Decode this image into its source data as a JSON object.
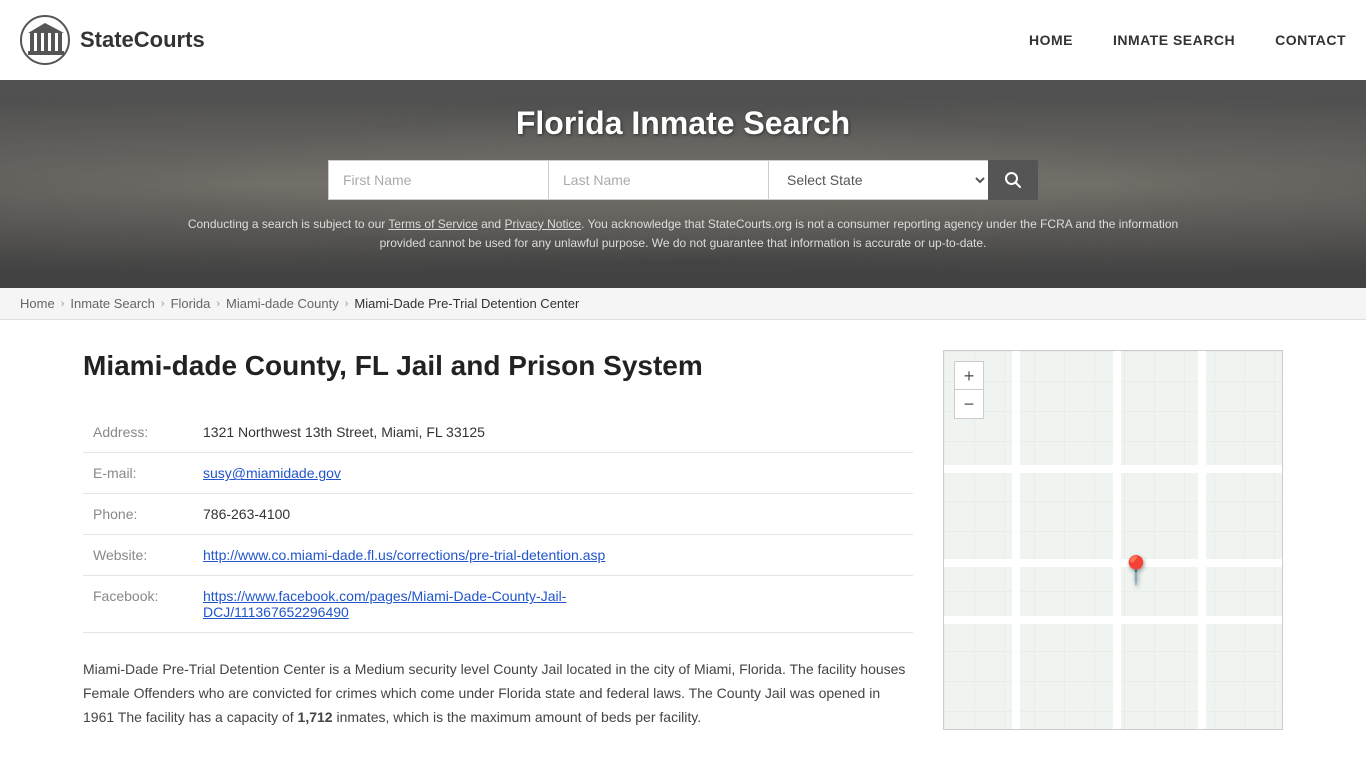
{
  "site": {
    "logo_text": "StateCourts",
    "title": "Florida Inmate Search"
  },
  "nav": {
    "home_label": "HOME",
    "inmate_search_label": "INMATE SEARCH",
    "contact_label": "CONTACT"
  },
  "search": {
    "first_name_placeholder": "First Name",
    "last_name_placeholder": "Last Name",
    "state_placeholder": "Select State",
    "search_button_label": "🔍"
  },
  "disclaimer": {
    "text_before_tos": "Conducting a search is subject to our ",
    "tos_label": "Terms of Service",
    "text_between": " and ",
    "privacy_label": "Privacy Notice",
    "text_after": ". You acknowledge that StateCourts.org is not a consumer reporting agency under the FCRA and the information provided cannot be used for any unlawful purpose. We do not guarantee that information is accurate or up-to-date."
  },
  "breadcrumb": {
    "home": "Home",
    "inmate_search": "Inmate Search",
    "state": "Florida",
    "county": "Miami-dade County",
    "facility": "Miami-Dade Pre-Trial Detention Center"
  },
  "facility": {
    "heading": "Miami-dade County, FL Jail and Prison System",
    "address_label": "Address:",
    "address_value": "1321 Northwest 13th Street, Miami, FL 33125",
    "email_label": "E-mail:",
    "email_value": "susy@miamidade.gov",
    "phone_label": "Phone:",
    "phone_value": "786-263-4100",
    "website_label": "Website:",
    "website_value": "http://www.co.miami-dade.fl.us/corrections/pre-trial-detention.asp",
    "facebook_label": "Facebook:",
    "facebook_value": "https://www.facebook.com/pages/Miami-Dade-County-Jail-DCJ/111367652296490",
    "facebook_display": "https://www.facebook.com/pages/Miami-Dade-County-Jail-\nDCJ/111367652296490",
    "description": "Miami-Dade Pre-Trial Detention Center is a Medium security level County Jail located in the city of Miami, Florida. The facility houses Female Offenders who are convicted for crimes which come under Florida state and federal laws. The County Jail was opened in 1961 The facility has a capacity of ",
    "capacity_bold": "1,712",
    "description_after": " inmates, which is the maximum amount of beds per facility."
  },
  "map": {
    "zoom_in_label": "+",
    "zoom_out_label": "−"
  }
}
